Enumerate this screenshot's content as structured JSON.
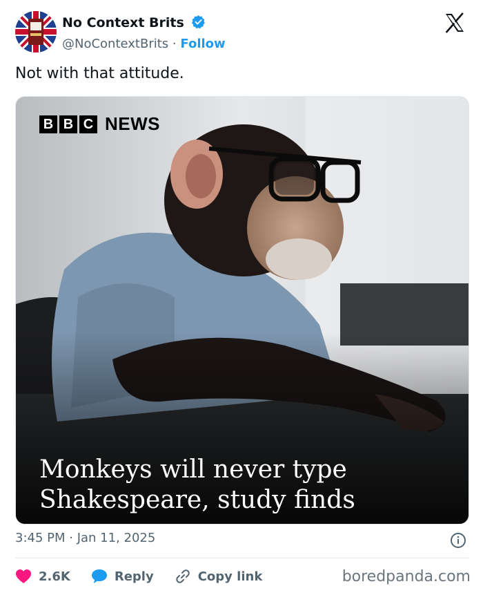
{
  "author": {
    "display_name": "No Context Brits",
    "handle": "@NoContextBrits",
    "separator": "·",
    "follow_label": "Follow",
    "verified": true
  },
  "tweet": {
    "text": "Not with that attitude."
  },
  "media": {
    "logo_letters": [
      "B",
      "B",
      "C"
    ],
    "logo_word": "NEWS",
    "headline_lines": [
      "Monkeys will never type",
      "Shakespeare, study finds"
    ]
  },
  "meta": {
    "timestamp": "3:45 PM · Jan 11, 2025"
  },
  "actions": {
    "likes": "2.6K",
    "reply_label": "Reply",
    "copy_label": "Copy link"
  },
  "watermark": "boredpanda.com",
  "colors": {
    "accent": "#1d9bf0",
    "like": "#f91880",
    "text": "#0f1419",
    "muted": "#536471"
  },
  "icons": [
    "verified-badge-icon",
    "x-logo-icon",
    "info-icon",
    "heart-icon",
    "reply-bubble-icon",
    "link-icon"
  ]
}
